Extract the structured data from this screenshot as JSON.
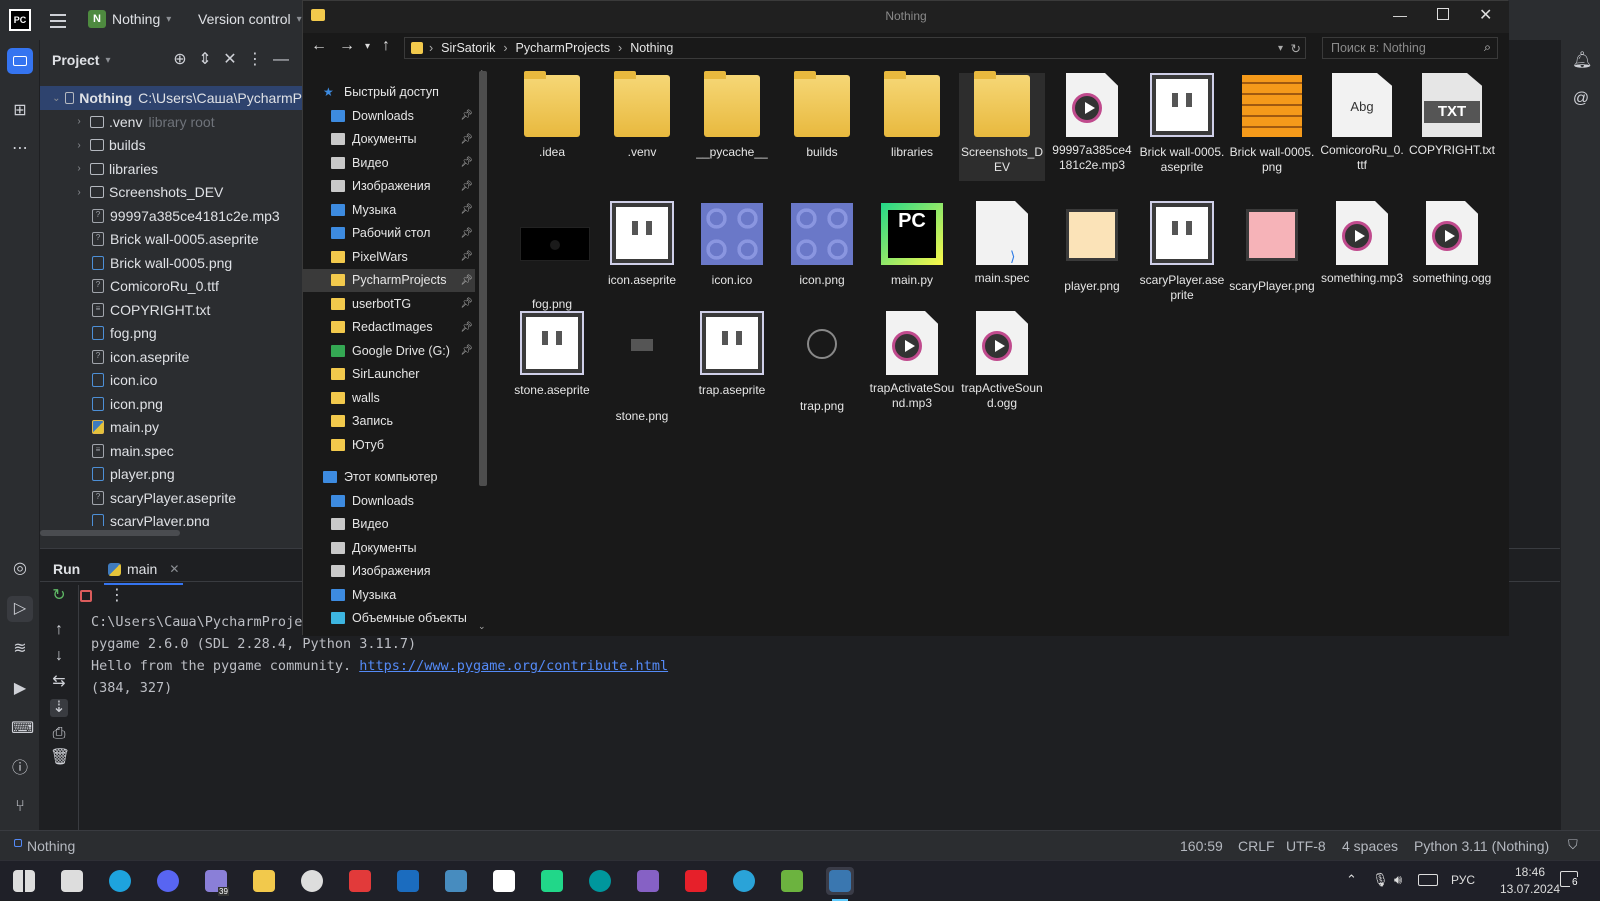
{
  "ide": {
    "logo": "PC",
    "project_badge": "N",
    "project_name": "Nothing",
    "vcs_label": "Version control",
    "panel_title": "Project",
    "tree": [
      {
        "label": "Nothing",
        "extra": "C:\\Users\\Саша\\PycharmP",
        "type": "folder-open",
        "selected": true,
        "indent": 1
      },
      {
        "label": ".venv",
        "extra": "library root",
        "type": "folder",
        "indent": 2
      },
      {
        "label": "builds",
        "type": "folder",
        "indent": 2
      },
      {
        "label": "libraries",
        "type": "folder",
        "indent": 2
      },
      {
        "label": "Screenshots_DEV",
        "type": "folder",
        "indent": 2
      },
      {
        "label": "99997a385ce4181c2e.mp3",
        "type": "unknown",
        "indent": 3
      },
      {
        "label": "Brick wall-0005.aseprite",
        "type": "unknown",
        "indent": 3
      },
      {
        "label": "Brick wall-0005.png",
        "type": "img",
        "indent": 3
      },
      {
        "label": "ComicoroRu_0.ttf",
        "type": "unknown",
        "indent": 3
      },
      {
        "label": "COPYRIGHT.txt",
        "type": "text",
        "indent": 3
      },
      {
        "label": "fog.png",
        "type": "img",
        "indent": 3
      },
      {
        "label": "icon.aseprite",
        "type": "unknown",
        "indent": 3
      },
      {
        "label": "icon.ico",
        "type": "img",
        "indent": 3
      },
      {
        "label": "icon.png",
        "type": "img",
        "indent": 3
      },
      {
        "label": "main.py",
        "type": "py",
        "indent": 3
      },
      {
        "label": "main.spec",
        "type": "text",
        "indent": 3
      },
      {
        "label": "player.png",
        "type": "img",
        "indent": 3
      },
      {
        "label": "scaryPlayer.aseprite",
        "type": "unknown",
        "indent": 3
      },
      {
        "label": "scaryPlayer.png",
        "type": "img",
        "indent": 3
      }
    ],
    "run": {
      "title": "Run",
      "tab_label": "main",
      "console_lines": [
        {
          "text": "C:\\Users\\Саша\\PycharmProjec"
        },
        {
          "text": "pygame 2.6.0 (SDL 2.28.4, Python 3.11.7)"
        },
        {
          "text": "Hello from the pygame community. ",
          "link": "https://www.pygame.org/contribute.html"
        },
        {
          "text": "(384, 327)"
        }
      ]
    },
    "status": {
      "project": "Nothing",
      "position": "160:59",
      "line_ending": "CRLF",
      "encoding": "UTF-8",
      "indent": "4 spaces",
      "interpreter": "Python 3.11 (Nothing)"
    }
  },
  "explorer": {
    "title": "Nothing",
    "breadcrumb": [
      "SirSatorik",
      "PycharmProjects",
      "Nothing"
    ],
    "search_placeholder": "Поиск в: Nothing",
    "quick_access_label": "Быстрый доступ",
    "nav": [
      {
        "label": "Downloads",
        "icon": "download-icon",
        "pinned": true
      },
      {
        "label": "Документы",
        "icon": "documents-icon",
        "pinned": true
      },
      {
        "label": "Видео",
        "icon": "video-icon",
        "pinned": true
      },
      {
        "label": "Изображения",
        "icon": "pictures-icon",
        "pinned": true
      },
      {
        "label": "Музыка",
        "icon": "music-icon",
        "pinned": true
      },
      {
        "label": "Рабочий стол",
        "icon": "desktop-icon",
        "pinned": true
      },
      {
        "label": "PixelWars",
        "icon": "folder-icon",
        "pinned": true
      },
      {
        "label": "PycharmProjects",
        "icon": "folder-icon",
        "pinned": true,
        "selected": true
      },
      {
        "label": "userbotTG",
        "icon": "folder-icon",
        "pinned": true
      },
      {
        "label": "RedactImages",
        "icon": "folder-icon",
        "pinned": true
      },
      {
        "label": "Google Drive (G:)",
        "icon": "google-drive-icon",
        "pinned": true
      },
      {
        "label": "SirLauncher",
        "icon": "folder-icon",
        "pinned": false
      },
      {
        "label": "walls",
        "icon": "folder-icon",
        "pinned": false
      },
      {
        "label": "Запись",
        "icon": "folder-icon",
        "pinned": false
      },
      {
        "label": "Ютуб",
        "icon": "folder-icon",
        "pinned": false
      }
    ],
    "this_pc_label": "Этот компьютер",
    "nav_pc": [
      {
        "label": "Downloads",
        "icon": "download-icon"
      },
      {
        "label": "Видео",
        "icon": "video-icon"
      },
      {
        "label": "Документы",
        "icon": "documents-icon"
      },
      {
        "label": "Изображения",
        "icon": "pictures-icon"
      },
      {
        "label": "Музыка",
        "icon": "music-icon"
      },
      {
        "label": "Объемные объекты",
        "icon": "3d-objects-icon"
      }
    ],
    "files": [
      {
        "label": ".idea",
        "kind": "folder"
      },
      {
        "label": ".venv",
        "kind": "folder"
      },
      {
        "label": "__pycache__",
        "kind": "folder"
      },
      {
        "label": "builds",
        "kind": "folder"
      },
      {
        "label": "libraries",
        "kind": "folder"
      },
      {
        "label": "Screenshots_DEV",
        "kind": "folder",
        "selected": true
      },
      {
        "label": "99997a385ce4181c2e.mp3",
        "kind": "media"
      },
      {
        "label": "Brick wall-0005.aseprite",
        "kind": "face"
      },
      {
        "label": "Brick wall-0005.png",
        "kind": "brick"
      },
      {
        "label": "ComicoroRu_0.ttf",
        "kind": "font",
        "glyph": "Abg"
      },
      {
        "label": "COPYRIGHT.txt",
        "kind": "txt",
        "glyph": "TXT"
      },
      {
        "label": "fog.png",
        "kind": "fog"
      },
      {
        "label": "icon.aseprite",
        "kind": "face"
      },
      {
        "label": "icon.ico",
        "kind": "pattern"
      },
      {
        "label": "icon.png",
        "kind": "pattern"
      },
      {
        "label": "main.py",
        "kind": "pycharm",
        "glyph": "PC"
      },
      {
        "label": "main.spec",
        "kind": "spec"
      },
      {
        "label": "player.png",
        "kind": "player"
      },
      {
        "label": "scaryPlayer.aseprite",
        "kind": "face"
      },
      {
        "label": "scaryPlayer.png",
        "kind": "scary"
      },
      {
        "label": "something.mp3",
        "kind": "media"
      },
      {
        "label": "something.ogg",
        "kind": "media"
      },
      {
        "label": "stone.aseprite",
        "kind": "face"
      },
      {
        "label": "stone.png",
        "kind": "stone"
      },
      {
        "label": "trap.aseprite",
        "kind": "face"
      },
      {
        "label": "trap.png",
        "kind": "trap"
      },
      {
        "label": "trapActivateSound.mp3",
        "kind": "media"
      },
      {
        "label": "trapActiveSound.ogg",
        "kind": "media"
      }
    ]
  },
  "taskbar": {
    "apps": [
      "start-icon",
      "task-view-icon",
      "edge-icon",
      "discord-icon",
      "app-icon",
      "file-explorer-icon",
      "obs-icon",
      "app-icon",
      "steam-icon",
      "godot-icon",
      "aseprite-icon",
      "pycharm-icon",
      "arduino-icon",
      "visual-studio-icon",
      "kaspersky-icon",
      "telegram-icon",
      "minecraft-icon",
      "python-icon"
    ],
    "badge": "39",
    "lang": "РУС",
    "time": "18:46",
    "date": "13.07.2024",
    "notif_count": "6"
  }
}
